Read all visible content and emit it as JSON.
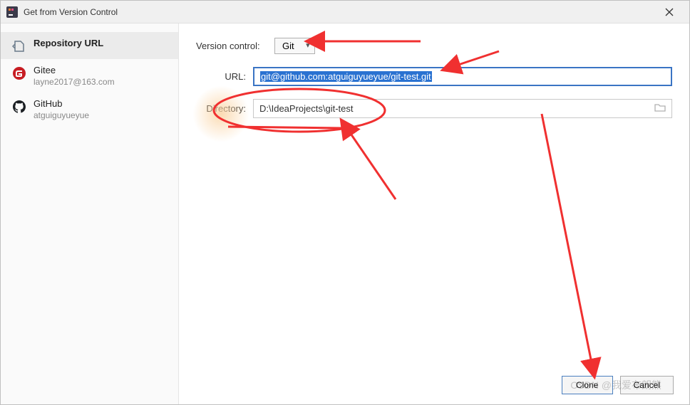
{
  "titlebar": {
    "title": "Get from Version Control"
  },
  "sidebar": {
    "items": [
      {
        "label": "Repository URL",
        "sub": ""
      },
      {
        "label": "Gitee",
        "sub": "layne2017@163.com"
      },
      {
        "label": "GitHub",
        "sub": "atguiguyueyue"
      }
    ]
  },
  "main": {
    "vc_label": "Version control:",
    "vc_value": "Git",
    "url_label": "URL:",
    "url_value": "git@github.com:atguiguyueyue/git-test.git",
    "dir_label": "Directory:",
    "dir_value": "D:\\IdeaProjects\\git-test"
  },
  "footer": {
    "clone": "Clone",
    "cancel": "Cancel"
  },
  "watermark": "CSDN @我爱布朗熊"
}
